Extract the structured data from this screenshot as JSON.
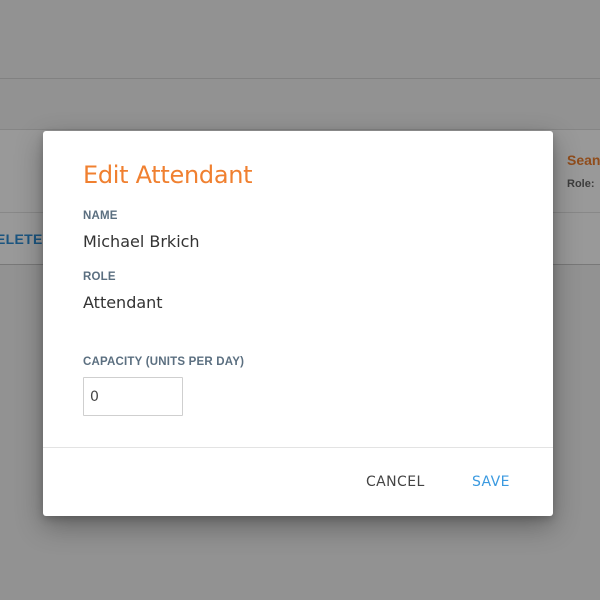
{
  "background": {
    "delete_label": "ELETE",
    "other_attendant_name": "Sean",
    "other_attendant_role": "Role: "
  },
  "dialog": {
    "title": "Edit Attendant",
    "name_label": "NAME",
    "name_value": "Michael Brkich",
    "role_label": "ROLE",
    "role_value": "Attendant",
    "capacity_label": "CAPACITY (UNITS PER DAY)",
    "capacity_value": "0",
    "cancel_label": "CANCEL",
    "save_label": "SAVE"
  },
  "colors": {
    "title_accent": "#f08030",
    "primary_action": "#3b9ae0",
    "label_text": "#5b6f80"
  }
}
